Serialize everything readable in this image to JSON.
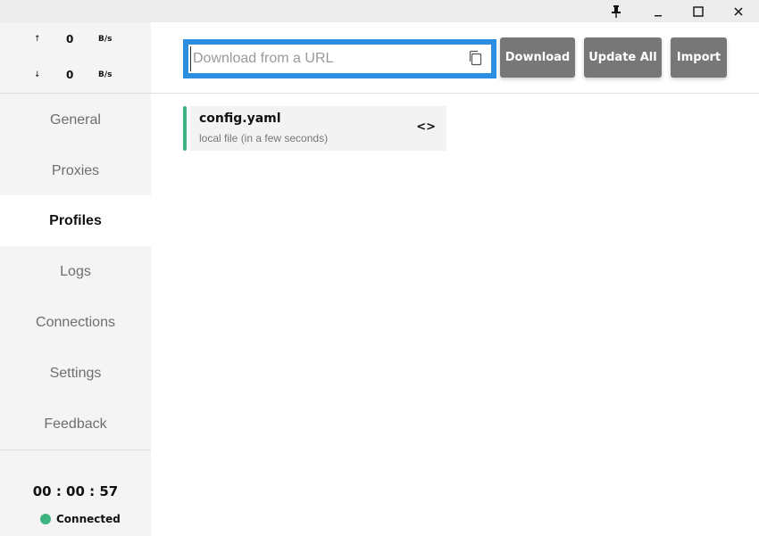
{
  "window": {
    "pin_icon": "pin-icon",
    "minimize_icon": "minimize-icon",
    "maximize_icon": "maximize-icon",
    "close_icon": "close-icon"
  },
  "speed": {
    "up_arrow": "↑",
    "up_value": "0",
    "up_unit": "B/s",
    "down_arrow": "↓",
    "down_value": "0",
    "down_unit": "B/s"
  },
  "nav": {
    "items": [
      {
        "label": "General"
      },
      {
        "label": "Proxies"
      },
      {
        "label": "Profiles"
      },
      {
        "label": "Logs"
      },
      {
        "label": "Connections"
      },
      {
        "label": "Settings"
      },
      {
        "label": "Feedback"
      }
    ],
    "active": "Profiles"
  },
  "status": {
    "timer": "00 : 00 : 57",
    "label": "Connected",
    "color": "#3fb37f"
  },
  "toolbar": {
    "url_placeholder": "Download from a URL",
    "url_value": "",
    "download_label": "Download",
    "update_all_label": "Update All",
    "import_label": "Import"
  },
  "profiles": [
    {
      "name": "config.yaml",
      "subtitle": "local file (in a few seconds)",
      "accent": "#3fb37f"
    }
  ],
  "colors": {
    "accent_blue": "#2b8ee0",
    "button_gray": "#777777",
    "status_green": "#3fb37f"
  }
}
